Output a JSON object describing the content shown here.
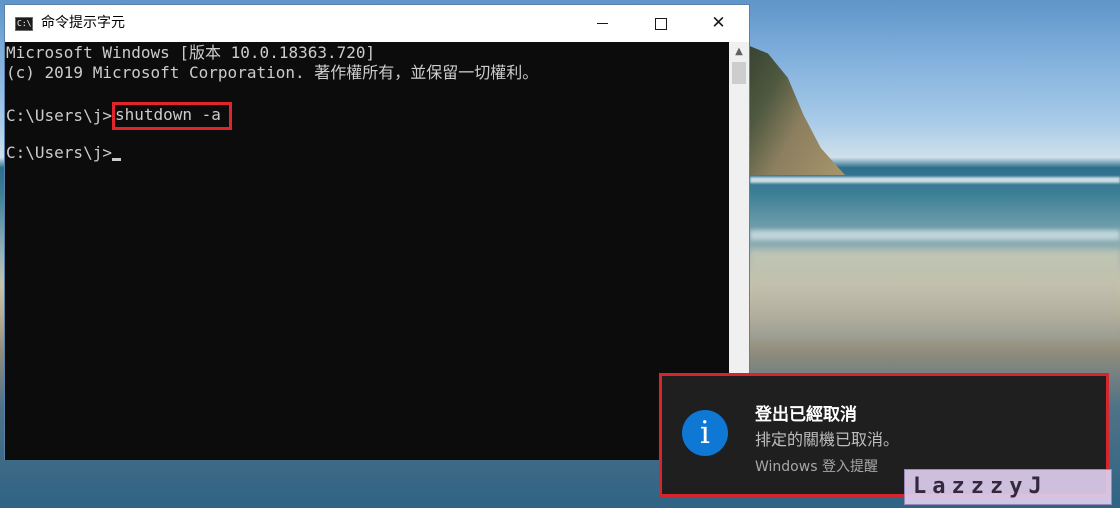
{
  "window": {
    "title": "命令提示字元",
    "icon_label": "C:\\",
    "buttons": {
      "minimize": "minimize-icon",
      "maximize": "maximize-icon",
      "close": "✕"
    }
  },
  "console": {
    "lines": [
      "Microsoft Windows [版本 10.0.18363.720]",
      "(c) 2019 Microsoft Corporation. 著作權所有，並保留一切權利。"
    ],
    "prompt": "C:\\Users\\j>",
    "command": "shutdown -a",
    "colors": {
      "background": "#0c0c0c",
      "text": "#cccccc",
      "highlight_border": "#e1252c"
    }
  },
  "notification": {
    "title": "登出已經取消",
    "body": "排定的關機已取消。",
    "source": "Windows 登入提醒",
    "icon": "i",
    "colors": {
      "background": "#1f1f1f",
      "icon": "#0f78d4",
      "highlight_border": "#d7252d"
    }
  },
  "watermark": {
    "text": "LazzzyJ"
  }
}
